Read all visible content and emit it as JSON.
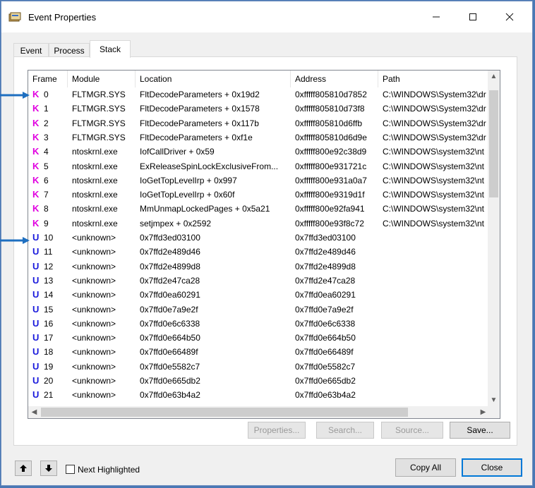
{
  "window": {
    "title": "Event Properties"
  },
  "tabs": [
    {
      "label": "Event"
    },
    {
      "label": "Process"
    },
    {
      "label": "Stack"
    }
  ],
  "columns": [
    "Frame",
    "Module",
    "Location",
    "Address",
    "Path"
  ],
  "rows": [
    {
      "kind": "K",
      "frame": "0",
      "module": "FLTMGR.SYS",
      "location": "FltDecodeParameters + 0x19d2",
      "address": "0xfffff805810d7852",
      "path": "C:\\WINDOWS\\System32\\dr"
    },
    {
      "kind": "K",
      "frame": "1",
      "module": "FLTMGR.SYS",
      "location": "FltDecodeParameters + 0x1578",
      "address": "0xfffff805810d73f8",
      "path": "C:\\WINDOWS\\System32\\dr"
    },
    {
      "kind": "K",
      "frame": "2",
      "module": "FLTMGR.SYS",
      "location": "FltDecodeParameters + 0x117b",
      "address": "0xfffff805810d6ffb",
      "path": "C:\\WINDOWS\\System32\\dr"
    },
    {
      "kind": "K",
      "frame": "3",
      "module": "FLTMGR.SYS",
      "location": "FltDecodeParameters + 0xf1e",
      "address": "0xfffff805810d6d9e",
      "path": "C:\\WINDOWS\\System32\\dr"
    },
    {
      "kind": "K",
      "frame": "4",
      "module": "ntoskrnl.exe",
      "location": "IofCallDriver + 0x59",
      "address": "0xfffff800e92c38d9",
      "path": "C:\\WINDOWS\\system32\\nt"
    },
    {
      "kind": "K",
      "frame": "5",
      "module": "ntoskrnl.exe",
      "location": "ExReleaseSpinLockExclusiveFrom...",
      "address": "0xfffff800e931721c",
      "path": "C:\\WINDOWS\\system32\\nt"
    },
    {
      "kind": "K",
      "frame": "6",
      "module": "ntoskrnl.exe",
      "location": "IoGetTopLevelIrp + 0x997",
      "address": "0xfffff800e931a0a7",
      "path": "C:\\WINDOWS\\system32\\nt"
    },
    {
      "kind": "K",
      "frame": "7",
      "module": "ntoskrnl.exe",
      "location": "IoGetTopLevelIrp + 0x60f",
      "address": "0xfffff800e9319d1f",
      "path": "C:\\WINDOWS\\system32\\nt"
    },
    {
      "kind": "K",
      "frame": "8",
      "module": "ntoskrnl.exe",
      "location": "MmUnmapLockedPages + 0x5a21",
      "address": "0xfffff800e92fa941",
      "path": "C:\\WINDOWS\\system32\\nt"
    },
    {
      "kind": "K",
      "frame": "9",
      "module": "ntoskrnl.exe",
      "location": "setjmpex + 0x2592",
      "address": "0xfffff800e93f8c72",
      "path": "C:\\WINDOWS\\system32\\nt"
    },
    {
      "kind": "U",
      "frame": "10",
      "module": "<unknown>",
      "location": "0x7ffd3ed03100",
      "address": "0x7ffd3ed03100",
      "path": ""
    },
    {
      "kind": "U",
      "frame": "11",
      "module": "<unknown>",
      "location": "0x7ffd2e489d46",
      "address": "0x7ffd2e489d46",
      "path": ""
    },
    {
      "kind": "U",
      "frame": "12",
      "module": "<unknown>",
      "location": "0x7ffd2e4899d8",
      "address": "0x7ffd2e4899d8",
      "path": ""
    },
    {
      "kind": "U",
      "frame": "13",
      "module": "<unknown>",
      "location": "0x7ffd2e47ca28",
      "address": "0x7ffd2e47ca28",
      "path": ""
    },
    {
      "kind": "U",
      "frame": "14",
      "module": "<unknown>",
      "location": "0x7ffd0ea60291",
      "address": "0x7ffd0ea60291",
      "path": ""
    },
    {
      "kind": "U",
      "frame": "15",
      "module": "<unknown>",
      "location": "0x7ffd0e7a9e2f",
      "address": "0x7ffd0e7a9e2f",
      "path": ""
    },
    {
      "kind": "U",
      "frame": "16",
      "module": "<unknown>",
      "location": "0x7ffd0e6c6338",
      "address": "0x7ffd0e6c6338",
      "path": ""
    },
    {
      "kind": "U",
      "frame": "17",
      "module": "<unknown>",
      "location": "0x7ffd0e664b50",
      "address": "0x7ffd0e664b50",
      "path": ""
    },
    {
      "kind": "U",
      "frame": "18",
      "module": "<unknown>",
      "location": "0x7ffd0e66489f",
      "address": "0x7ffd0e66489f",
      "path": ""
    },
    {
      "kind": "U",
      "frame": "19",
      "module": "<unknown>",
      "location": "0x7ffd0e5582c7",
      "address": "0x7ffd0e5582c7",
      "path": ""
    },
    {
      "kind": "U",
      "frame": "20",
      "module": "<unknown>",
      "location": "0x7ffd0e665db2",
      "address": "0x7ffd0e665db2",
      "path": ""
    },
    {
      "kind": "U",
      "frame": "21",
      "module": "<unknown>",
      "location": "0x7ffd0e63b4a2",
      "address": "0x7ffd0e63b4a2",
      "path": ""
    }
  ],
  "buttons": {
    "properties": "Properties...",
    "search": "Search...",
    "source": "Source...",
    "save": "Save...",
    "copy_all": "Copy All",
    "close": "Close"
  },
  "next_highlighted": "Next Highlighted",
  "colors": {
    "kernel": "#e000e0",
    "user": "#1a1adc",
    "arrow": "#1e6fc0",
    "focus": "#0078d7"
  }
}
